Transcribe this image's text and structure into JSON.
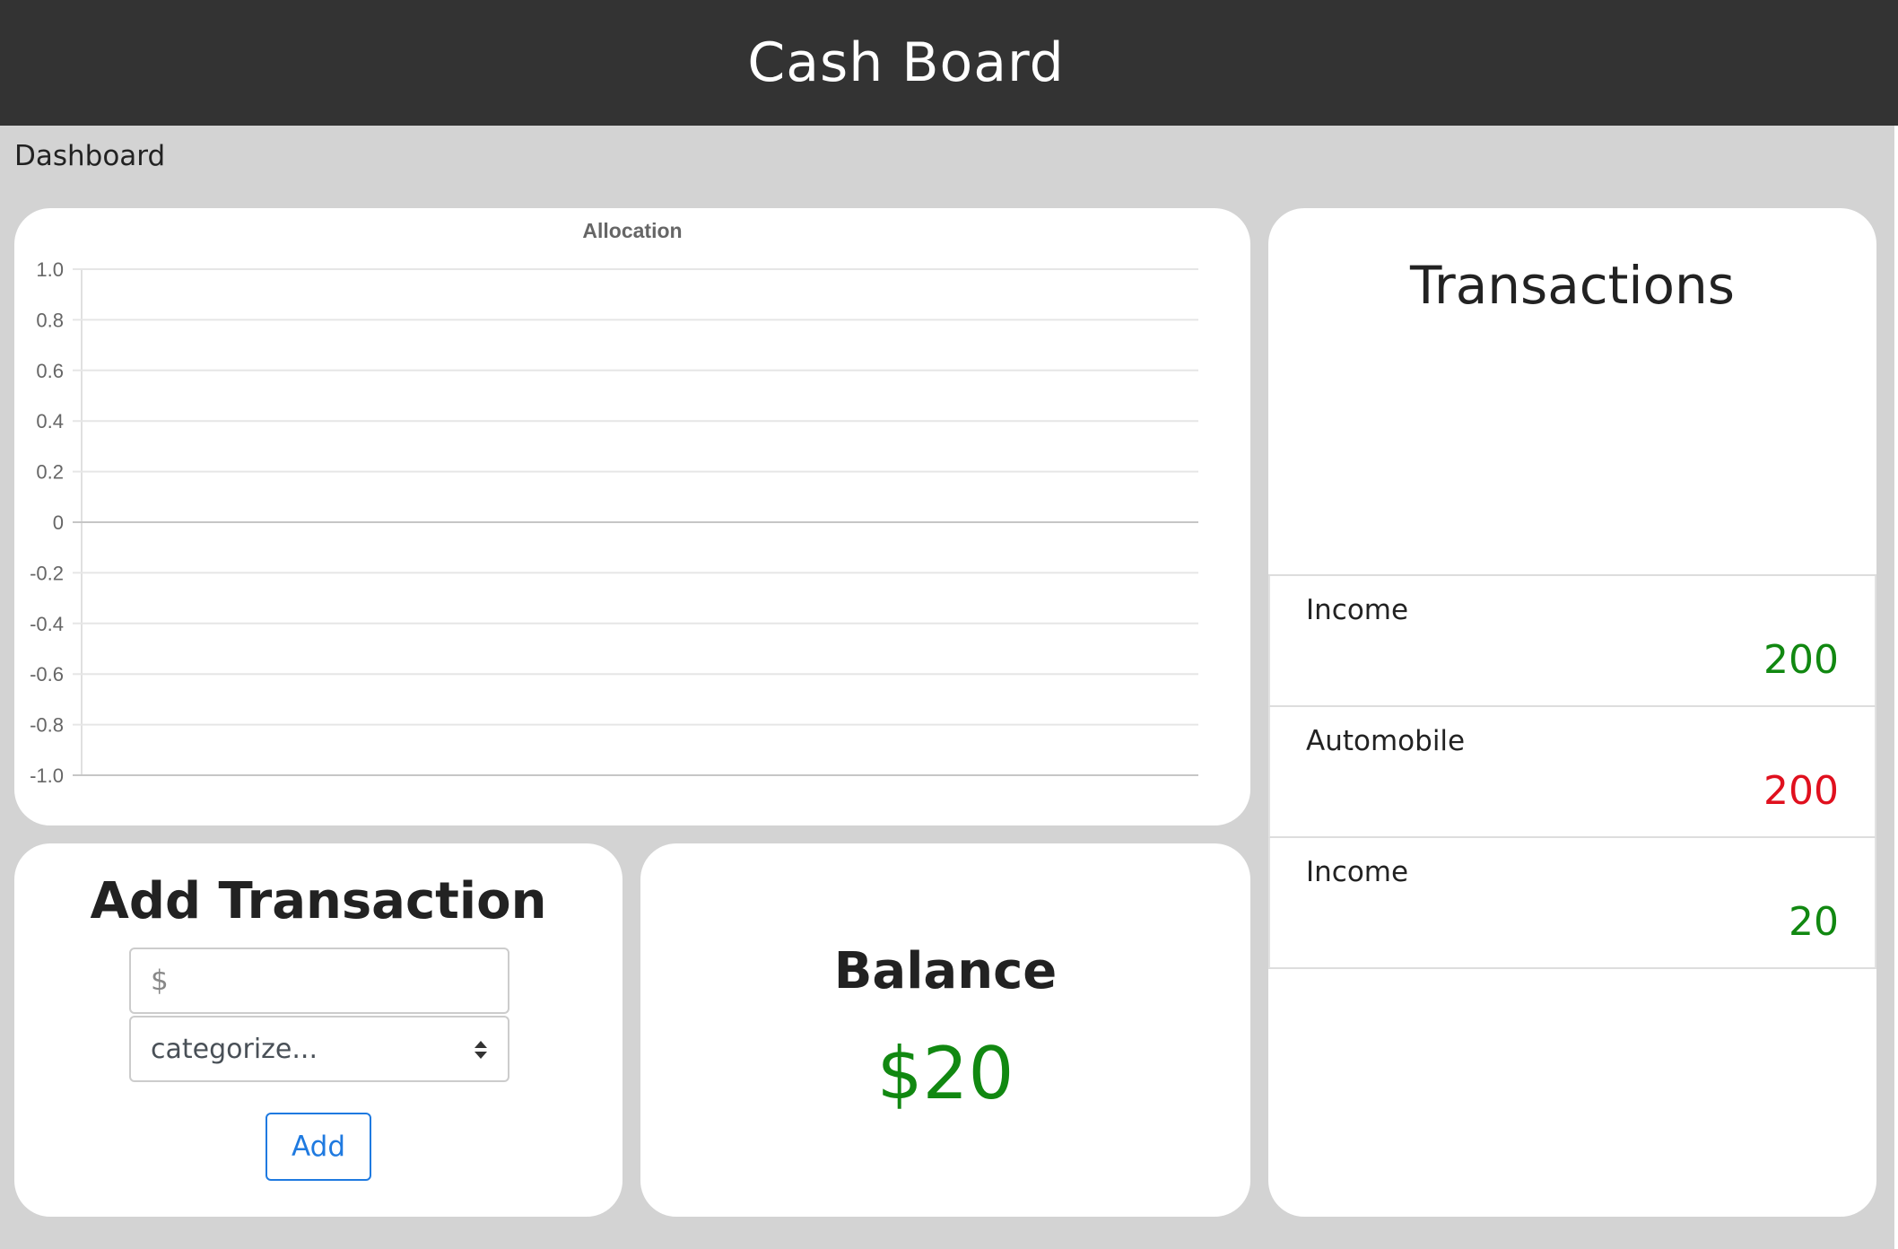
{
  "header": {
    "title": "Cash Board"
  },
  "breadcrumb": {
    "label": "Dashboard"
  },
  "chart_data": {
    "type": "bar",
    "title": "Allocation",
    "categories": [],
    "series": [],
    "xlabel": "",
    "ylabel": "",
    "ylim": [
      -1.0,
      1.0
    ],
    "yticks": [
      "1.0",
      "0.8",
      "0.6",
      "0.4",
      "0.2",
      "0",
      "-0.2",
      "-0.4",
      "-0.6",
      "-0.8",
      "-1.0"
    ],
    "grid": true
  },
  "transactions": {
    "title": "Transactions",
    "items": [
      {
        "category": "Income",
        "amount": "200",
        "color": "#118811"
      },
      {
        "category": "Automobile",
        "amount": "200",
        "color": "#e0101e"
      },
      {
        "category": "Income",
        "amount": "20",
        "color": "#118811"
      }
    ]
  },
  "add_transaction": {
    "title": "Add Transaction",
    "amount_placeholder": "$",
    "amount_value": "",
    "category_selected": "categorize...",
    "add_label": "Add",
    "accent_color": "#1f7ae0"
  },
  "balance": {
    "label": "Balance",
    "value": "$20",
    "color": "#118811"
  }
}
